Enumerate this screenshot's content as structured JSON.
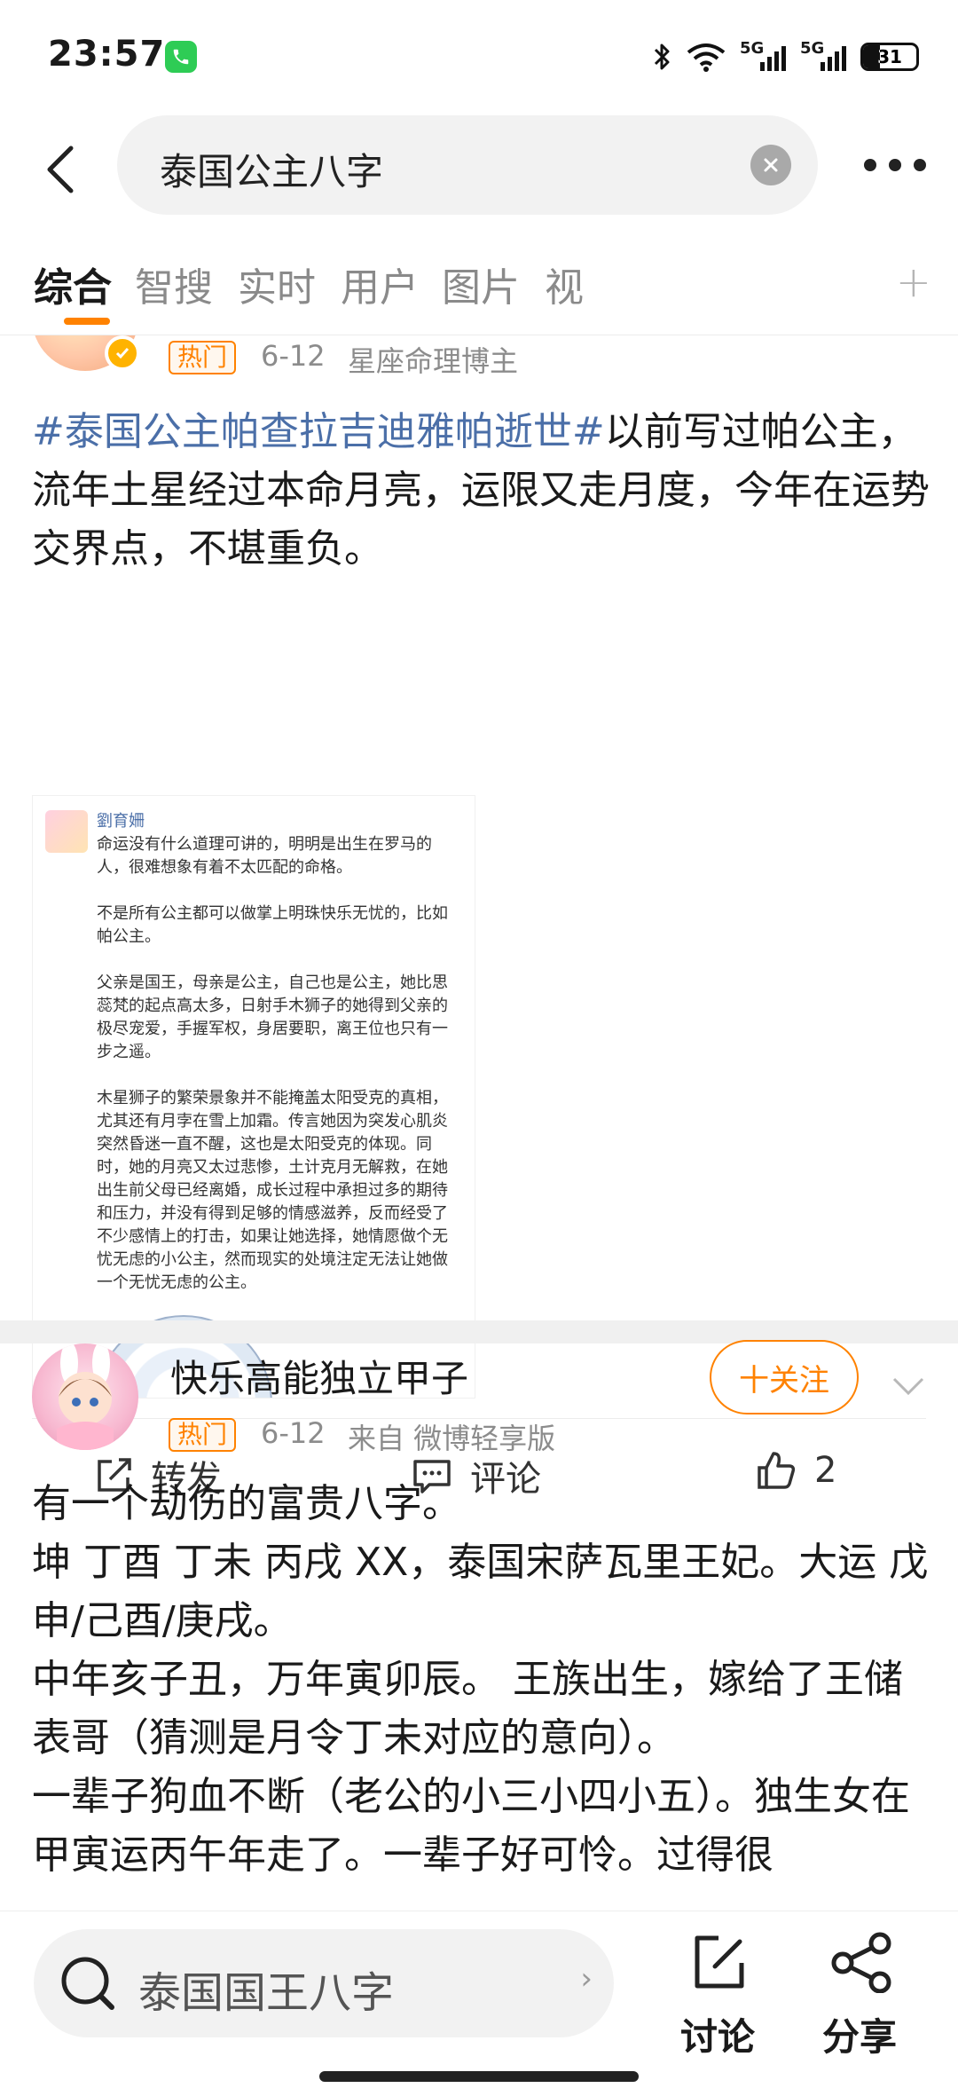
{
  "status_bar": {
    "time": "23:57",
    "network_1": "5G",
    "network_2": "5G",
    "battery": "31",
    "battery_level_percent": 31
  },
  "search": {
    "query": "泰国公主八字"
  },
  "tabs": [
    {
      "label": "综合",
      "active": true
    },
    {
      "label": "智搜",
      "active": false
    },
    {
      "label": "实时",
      "active": false
    },
    {
      "label": "用户",
      "active": false
    },
    {
      "label": "图片",
      "active": false
    },
    {
      "label": "视",
      "active": false
    }
  ],
  "post1": {
    "hot_badge": "热门",
    "date": "6-12",
    "source": "星座命理博主",
    "topic": "#泰国公主帕查拉吉迪雅帕逝世#",
    "text": "以前写过帕公主，流年土星经过本命月亮，运限又走月度，今年在运势交界点，不堪重负。",
    "image": {
      "author": "劉育姍",
      "paragraphs": [
        "命运没有什么道理可讲的，明明是出生在罗马的人，很难想象有着不太匹配的命格。",
        "不是所有公主都可以做掌上明珠快乐无忧的，比如帕公主。",
        "父亲是国王，母亲是公主，自己也是公主，她比思蕊梵的起点高太多，日射手木狮子的她得到父亲的极尽宠爱，手握军权，身居要职，离王位也只有一步之遥。",
        "木星狮子的繁荣景象并不能掩盖太阳受克的真相，尤其还有月孛在雪上加霜。传言她因为突发心肌炎突然昏迷一直不醒，这也是太阳受克的体现。同时，她的月亮又太过悲惨，土计克月无解救，在她出生前父母已经离婚，成长过程中承担过多的期待和压力，并没有得到足够的情感滋养，反而经受了不少感情上的打击，如果让她选择，她情愿做个无忧无虑的小公主，然而现实的处境注定无法让她做一个无忧无虑的公主。"
      ]
    },
    "actions": {
      "repost": "转发",
      "comment": "评论",
      "like_count": "2"
    }
  },
  "post2": {
    "username": "快乐高能独立甲子",
    "follow": "十关注",
    "hot_badge": "热门",
    "date": "6-12",
    "source": "来自 微博轻享版",
    "lines": [
      "有一个劫伤的富贵八字。",
      "坤 丁酉 丁未 丙戌 XX，泰国宋萨瓦里王妃。大运 戊申/己酉/庚戌。",
      "中年亥子丑，万年寅卯辰。 王族出生，嫁给了王储表哥（猜测是月令丁未对应的意向）。",
      "一辈子狗血不断（老公的小三小四小五）。独生女在甲寅运丙午年走了。一辈子好可怜。过得很"
    ]
  },
  "bottom": {
    "search_suggestion": "泰国国王八字",
    "discuss": "讨论",
    "share": "分享"
  }
}
